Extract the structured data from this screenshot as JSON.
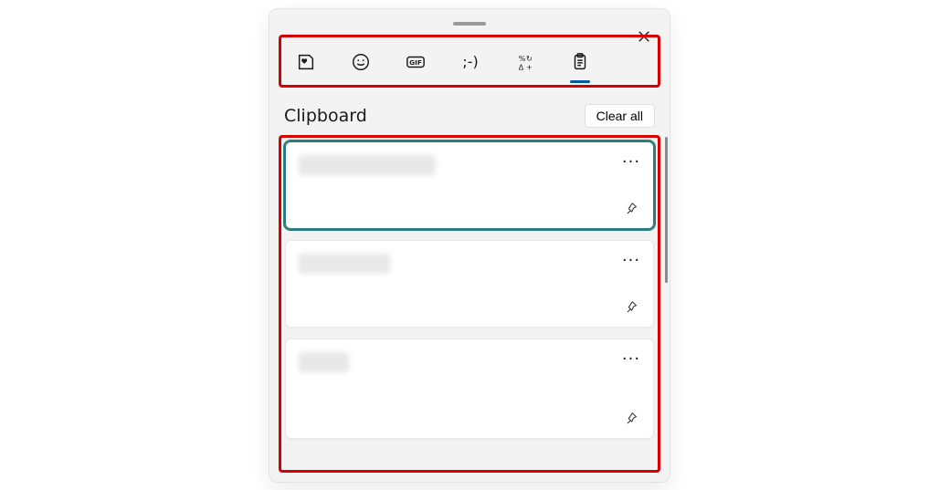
{
  "panel": {
    "section_title": "Clipboard",
    "clear_all_label": "Clear all"
  },
  "tabs": [
    {
      "id": "recent",
      "icon": "sticker-heart-icon",
      "active": false
    },
    {
      "id": "emoji",
      "icon": "smiley-icon",
      "active": false
    },
    {
      "id": "gif",
      "icon": "gif-icon",
      "label": "GIF",
      "active": false
    },
    {
      "id": "kaomoji",
      "icon": "kaomoji-icon",
      "label": ";-)",
      "active": false
    },
    {
      "id": "symbols",
      "icon": "symbols-icon",
      "active": false
    },
    {
      "id": "clipboard",
      "icon": "clipboard-icon",
      "active": true
    }
  ],
  "clipboard_items": [
    {
      "selected": true,
      "text_width": "150px"
    },
    {
      "selected": false,
      "text_width": "100px"
    },
    {
      "selected": false,
      "text_width": "55px"
    }
  ],
  "highlight": {
    "tabs": true,
    "list": true
  }
}
